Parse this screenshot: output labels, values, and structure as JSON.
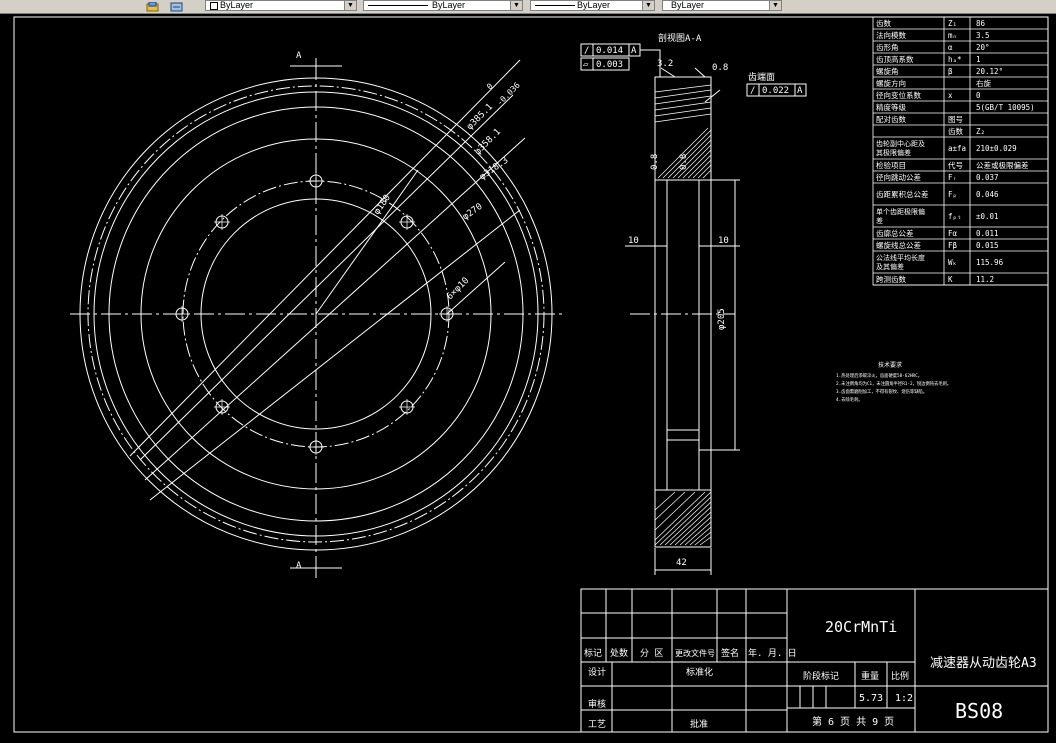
{
  "toolbar": {
    "layer_combo": "ByLayer",
    "linetype_combo": "ByLayer",
    "lineweight_combo": "ByLayer",
    "plotstyle_combo": "ByLayer"
  },
  "front_view": {
    "section_mark": "A",
    "dims": {
      "outer": "φ385.1",
      "outer_tol_upper": "0",
      "outer_tol_lower": "-0.036",
      "root": "φ358.1",
      "rim_inner": "φ318.3",
      "hub": "φ270",
      "bolt_circle": "φ180",
      "holes": "6×φ10"
    }
  },
  "side_view": {
    "title": "剖视图A-A",
    "gdt": [
      {
        "symbol": "/",
        "value": "0.014",
        "datum": "A"
      },
      {
        "symbol": "▱",
        "value": "0.003",
        "datum": ""
      },
      {
        "symbol": "/",
        "value": "0.022",
        "datum": "A"
      }
    ],
    "chamfer_left": "3.2",
    "chamfer_right": "0.8",
    "surface_note": "齿端面",
    "dim_left_10": "10",
    "dim_right_10": "10",
    "dim_bore": "φ205",
    "dim_width": "42",
    "rough_1": "0.8",
    "rough_2": "0.8"
  },
  "param_table": [
    {
      "name": "齿数",
      "sym": "Z₁",
      "val": "86"
    },
    {
      "name": "法向模数",
      "sym": "mₙ",
      "val": "3.5"
    },
    {
      "name": "齿形角",
      "sym": "α",
      "val": "20°"
    },
    {
      "name": "齿顶高系数",
      "sym": "hₐ*",
      "val": "1"
    },
    {
      "name": "螺旋角",
      "sym": "β",
      "val": "20.12°"
    },
    {
      "name": "螺旋方向",
      "sym": "",
      "val": "右旋"
    },
    {
      "name": "径向变位系数",
      "sym": "x",
      "val": "0"
    },
    {
      "name": "精度等级",
      "sym": "",
      "val": "5(GB/T 10095)"
    },
    {
      "name": "配对齿数",
      "sym": "图号",
      "val": ""
    },
    {
      "name": "",
      "sym": "齿数",
      "val": "Z₂"
    },
    {
      "name": "齿轮副中心距及其极限偏差",
      "sym": "a±fa",
      "val": "210±0.029"
    },
    {
      "name": "检验项目",
      "sym": "代号",
      "val": "公差或极限偏差"
    },
    {
      "name": "径向跳动公差",
      "sym": "Fᵣ",
      "val": "0.037"
    },
    {
      "name": "齿距累积总公差",
      "sym": "Fₚ",
      "val": "0.046"
    },
    {
      "name": "单个齿距极限偏差",
      "sym": "fₚₜ",
      "val": "±0.01"
    },
    {
      "name": "齿廓总公差",
      "sym": "Fα",
      "val": "0.011"
    },
    {
      "name": "螺旋线总公差",
      "sym": "Fβ",
      "val": "0.015"
    },
    {
      "name": "公法线平均长度及其偏差",
      "sym": "Wₖ",
      "val": "115.96"
    },
    {
      "name": "跨测齿数",
      "sym": "K",
      "val": "11.2"
    }
  ],
  "tech_requirements": {
    "title": "技术要求",
    "lines": [
      "1.热处理后渗碳淬火，齿面硬度58-62HRC。",
      "2.未注倒角均为C1，未注圆角半径R1-2，锐边倒钝去毛刺。",
      "3.齿面需磨削加工，不得有裂纹、烧伤等缺陷。",
      "4.去除毛刺。"
    ]
  },
  "title_block": {
    "material": "20CrMnTi",
    "part_name": "减速器从动齿轮A3",
    "drawing_no": "BS08",
    "row_labels": [
      "标记",
      "处数",
      "分 区",
      "更改文件号",
      "签名",
      "年. 月. 日"
    ],
    "design": "设计",
    "standardize": "标准化",
    "stage_mark": "阶段标记",
    "weight_label": "重量",
    "scale_label": "比例",
    "weight": "5.73",
    "scale": "1:2",
    "review": "审核",
    "process": "工艺",
    "approve": "批准",
    "sheet_info": "第 6 页  共 9 页"
  }
}
